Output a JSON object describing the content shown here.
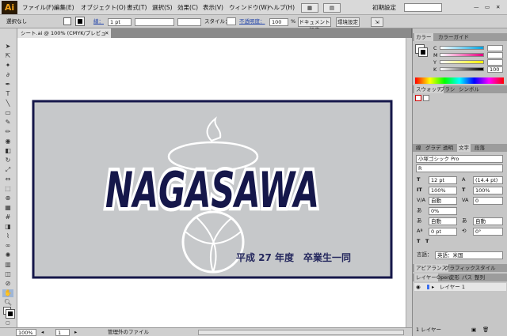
{
  "app": {
    "logo": "Ai"
  },
  "menu": [
    "ファイル(F)",
    "編集(E)",
    "オブジェクト(O)",
    "書式(T)",
    "選択(S)",
    "効果(C)",
    "表示(V)",
    "ウィンドウ(W)",
    "ヘルプ(H)"
  ],
  "menubar_right": {
    "workspace": "初期設定"
  },
  "control": {
    "selection": "選択なし",
    "stroke_label": "線：",
    "stroke_value": "1 pt",
    "style_label": "スタイル：",
    "opacity_label": "不透明度：",
    "opacity_value": "100",
    "opacity_unit": "%",
    "doc_setup_button": "ドキュメント設定",
    "prefs_button": "環境設定"
  },
  "document_tab": "シート.ai @ 100% (CMYK/プレビュー)",
  "artwork": {
    "logo_text": "NAGASAWA",
    "caption": "平成 27 年度　卒業生一同"
  },
  "status": {
    "zoom": "100%",
    "page": "1",
    "info": "管理外のファイル"
  },
  "color_panel": {
    "tabs": [
      "カラー",
      "カラーガイド"
    ],
    "channels": [
      {
        "label": "C",
        "value": "",
        "grad": "#00a3e0"
      },
      {
        "label": "M",
        "value": "",
        "grad": "#e4007f"
      },
      {
        "label": "Y",
        "value": "",
        "grad": "#fff100"
      },
      {
        "label": "K",
        "value": "100",
        "grad": "#000000"
      }
    ]
  },
  "swatch_panel": {
    "tabs": [
      "スウォッチ",
      "ブラシ",
      "シンボル"
    ]
  },
  "char_panel": {
    "tabs": [
      "線",
      "グラデ",
      "透明",
      "文字",
      "段落"
    ],
    "font_family": "小塚ゴシック Pro",
    "font_style": "R",
    "size": "12 pt",
    "leading": "(14.4 pt)",
    "vscale": "100%",
    "hscale": "100%",
    "kerning": "自動",
    "tracking": "0",
    "tsume": "0%",
    "aki_left": "自動",
    "aki_right": "自動",
    "baseline": "0 pt",
    "rotate": "0°",
    "tt": "T",
    "tt2": "T",
    "lang_label": "言語：",
    "lang_value": "英語：米国"
  },
  "appearance_panel": {
    "tabs": [
      "アピアランス",
      "グラフィックスタイル"
    ]
  },
  "layers_panel": {
    "tabs": [
      "レイヤー",
      "Open",
      "変形",
      "パス",
      "整列"
    ],
    "layer_name": "レイヤー 1",
    "footer": "1 レイヤー"
  },
  "colors": {
    "navy": "#15174a",
    "bg_gray": "#c6c8ca",
    "caption_navy": "#25285e",
    "ai_orange": "#f4a21a"
  }
}
